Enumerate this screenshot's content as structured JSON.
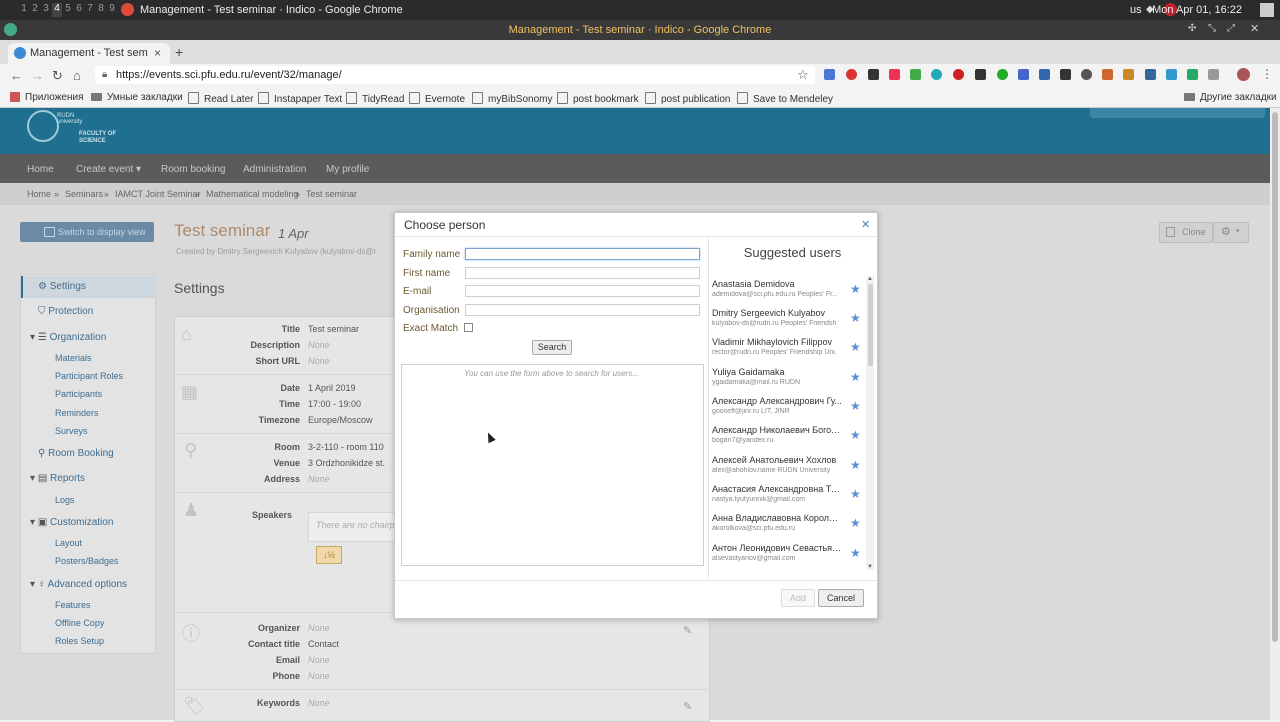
{
  "os": {
    "workspaces": [
      "1",
      "2",
      "3",
      "4",
      "5",
      "6",
      "7",
      "8",
      "9"
    ],
    "active_workspace": "4",
    "window_title": "Management - Test seminar · Indico - Google Chrome",
    "lang": "us",
    "clock": "Mon Apr 01, 16:22"
  },
  "browser": {
    "title": "Management - Test seminar · Indico - Google Chrome",
    "tab_label": "Management - Test seminar",
    "url": "https://events.sci.pfu.edu.ru/event/32/manage/",
    "bookmarks": [
      "Приложения",
      "Умные закладки",
      "Read Later",
      "Instapaper Text",
      "TidyRead",
      "Evernote",
      "myBibSonomy",
      "post bookmark",
      "post publication",
      "Save to Mendeley"
    ],
    "other_bookmarks": "Другие закладки"
  },
  "site": {
    "logo_line1": "RUDN university",
    "logo_line2": "FACULTY OF SCIENCE",
    "menu": [
      "Home",
      "Create event ▾",
      "Room booking",
      "Administration",
      "My profile"
    ],
    "breadcrumb": [
      "Home",
      "»",
      "Seminars",
      "»",
      "IAMCT Joint Seminar",
      "»",
      "Mathematical modeling",
      "»",
      "Test seminar"
    ],
    "switch_label": "Switch to display view",
    "clone_label": "Clone",
    "event_title": "Test seminar",
    "event_date": "1 Apr",
    "created_by": "Created by Dmitry Sergeevich Kulyabov (kulyabov-ds@r",
    "settings_heading": "Settings",
    "sidenav": {
      "settings": "Settings",
      "protection": "Protection",
      "organization": "Organization",
      "materials": "Materials",
      "participant_roles": "Participant Roles",
      "participants": "Participants",
      "reminders": "Reminders",
      "surveys": "Surveys",
      "room_booking": "Room Booking",
      "reports": "Reports",
      "logs": "Logs",
      "customization": "Customization",
      "layout": "Layout",
      "posters_badges": "Posters/Badges",
      "advanced_options": "Advanced options",
      "features": "Features",
      "offline_copy": "Offline Copy",
      "roles_setup": "Roles Setup"
    },
    "fields": {
      "title_k": "Title",
      "title_v": "Test seminar",
      "desc_k": "Description",
      "desc_v": "None",
      "short_k": "Short URL",
      "short_v": "None",
      "date_k": "Date",
      "date_v": "1 April 2019",
      "time_k": "Time",
      "time_v": "17:00 - 19:00",
      "tz_k": "Timezone",
      "tz_v": "Europe/Moscow",
      "room_k": "Room",
      "room_v": "3-2-110 - room 110",
      "venue_k": "Venue",
      "venue_v": "3 Ordzhonikidze st.",
      "addr_k": "Address",
      "addr_v": "None",
      "speakers_k": "Speakers",
      "speakers_v": "There are no chairp",
      "org_k": "Organizer",
      "org_v": "None",
      "contact_k": "Contact title",
      "contact_v": "Contact",
      "email_k": "Email",
      "email_v": "None",
      "phone_k": "Phone",
      "phone_v": "None",
      "kw_k": "Keywords",
      "kw_v": "None"
    }
  },
  "modal": {
    "title": "Choose person",
    "labels": {
      "family_name": "Family name",
      "first_name": "First name",
      "email": "E-mail",
      "organisation": "Organisation",
      "exact_match": "Exact Match"
    },
    "search_label": "Search",
    "results_hint": "You can use the form above to search for users...",
    "suggested_title": "Suggested users",
    "add_label": "Add",
    "cancel_label": "Cancel",
    "suggested": [
      {
        "name": "Anastasia Demidova",
        "email": "ademidova@sci.pfu.edu.ru   Peoples' Fr..."
      },
      {
        "name": "Dmitry Sergeevich Kulyabov",
        "email": "kulyabov-ds@rudn.ru   Peoples' Friendsh..."
      },
      {
        "name": "Vladimir Mikhaylovich Filippov",
        "email": "rector@rudn.ru   Peoples' Friendship Uni..."
      },
      {
        "name": "Yuliya Gaidamaka",
        "email": "ygaidamaka@mail.ru   RUDN"
      },
      {
        "name": "Александр Александрович Гу...",
        "email": "gooseff@jinr.ru   LIT, JINR"
      },
      {
        "name": "Александр Николаевич Богол...",
        "email": "bogan7@yandex.ru"
      },
      {
        "name": "Алексей Анатольевич Хохлов",
        "email": "alex@ahohlov.name   RUDN University"
      },
      {
        "name": "Анастасия Александровна Тю...",
        "email": "nastya.tyutyunnik@gmail.com"
      },
      {
        "name": "Анна Владиславовна Корольк...",
        "email": "akorolkova@sci.pfu.edu.ru"
      },
      {
        "name": "Антон Леонидович Севастьянов",
        "email": "alsevastyanov@gmail.com"
      }
    ]
  },
  "colors": {
    "header": "#1f7090",
    "star": "#5b8fd6",
    "title_accent": "#b08a6a"
  }
}
